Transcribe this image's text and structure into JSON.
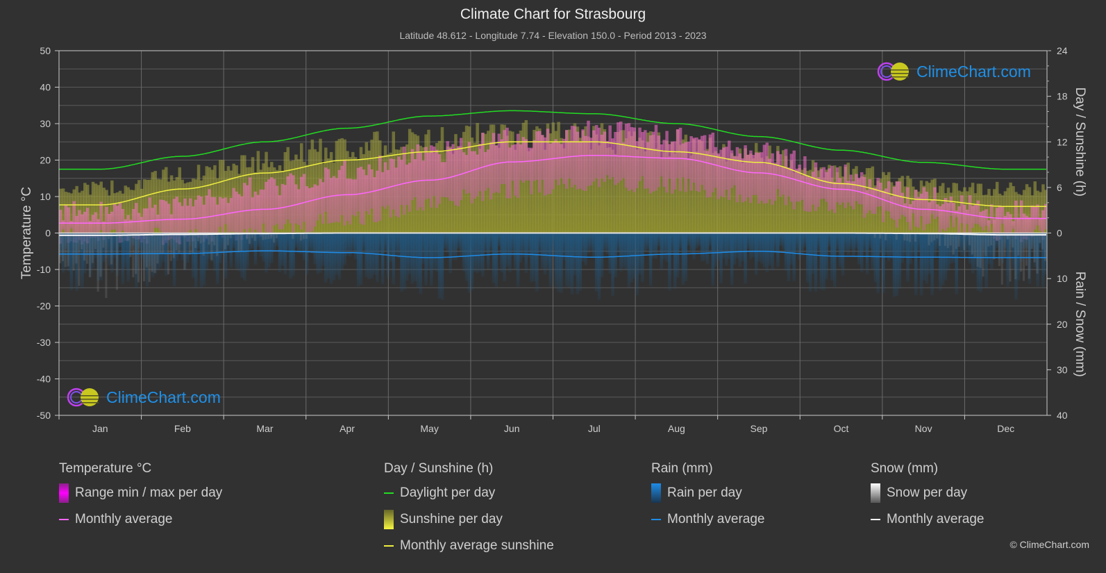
{
  "title": "Climate Chart for Strasbourg",
  "subtitle": "Latitude 48.612 - Longitude 7.74 - Elevation 150.0 - Period 2013 - 2023",
  "logo_text": "ClimeChart.com",
  "copyright": "© ClimeChart.com",
  "colors": {
    "background": "#313131",
    "temp_avg": "#ff66ff",
    "temp_range": "#e000e0",
    "daylight": "#22dd22",
    "sunshine_avg": "#f0f040",
    "sunshine_bar": "#bdbd3a",
    "rain_avg": "#1e8ce8",
    "rain_bar": "#1a70c0",
    "snow_avg": "#ffffff",
    "logo": "#1e90e8"
  },
  "legend": {
    "temperature": {
      "title": "Temperature °C",
      "items": [
        "Range min / max per day",
        "Monthly average"
      ]
    },
    "sunshine": {
      "title": "Day / Sunshine (h)",
      "items": [
        "Daylight per day",
        "Sunshine per day",
        "Monthly average sunshine"
      ]
    },
    "rain": {
      "title": "Rain (mm)",
      "items": [
        "Rain per day",
        "Monthly average"
      ]
    },
    "snow": {
      "title": "Snow (mm)",
      "items": [
        "Snow per day",
        "Monthly average"
      ]
    }
  },
  "chart_data": {
    "type": "line",
    "title": "Climate Chart for Strasbourg",
    "categories": [
      "Jan",
      "Feb",
      "Mar",
      "Apr",
      "May",
      "Jun",
      "Jul",
      "Aug",
      "Sep",
      "Oct",
      "Nov",
      "Dec"
    ],
    "y_left": {
      "label": "Temperature °C",
      "range": [
        -50,
        50
      ],
      "ticks": [
        50,
        40,
        30,
        20,
        10,
        0,
        -10,
        -20,
        -30,
        -40,
        -50
      ]
    },
    "y_right_top": {
      "label": "Day / Sunshine (h)",
      "range": [
        0,
        24
      ],
      "ticks": [
        24,
        18,
        12,
        6,
        0
      ]
    },
    "y_right_bottom": {
      "label": "Rain / Snow (mm)",
      "range": [
        0,
        40
      ],
      "ticks": [
        10,
        20,
        30,
        40
      ]
    },
    "grid": true,
    "legend_position": "bottom",
    "series": [
      {
        "name": "Temperature monthly average",
        "axis": "temp",
        "unit": "°C",
        "values": [
          2.7,
          3.8,
          6.5,
          10.5,
          14.5,
          19.5,
          21.3,
          20.5,
          16.5,
          12.0,
          6.5,
          4.0
        ]
      },
      {
        "name": "Temperature daily max (approx envelope)",
        "axis": "temp",
        "unit": "°C",
        "values": [
          6,
          8,
          13,
          17,
          22,
          26,
          28,
          27,
          22,
          16,
          10,
          6
        ]
      },
      {
        "name": "Temperature daily min (approx envelope)",
        "axis": "temp",
        "unit": "°C",
        "values": [
          -1,
          -1,
          1,
          4,
          8,
          12,
          14,
          13,
          10,
          7,
          3,
          0
        ]
      },
      {
        "name": "Daylight per day",
        "axis": "sun",
        "unit": "h",
        "values": [
          8.4,
          10.1,
          12.0,
          13.8,
          15.4,
          16.1,
          15.7,
          14.4,
          12.7,
          10.9,
          9.3,
          8.4
        ]
      },
      {
        "name": "Sunshine per day (approx max)",
        "axis": "sun",
        "unit": "h",
        "values": [
          6.5,
          8.5,
          10.5,
          12.5,
          13.5,
          14.2,
          14.0,
          13.0,
          11.5,
          9.0,
          7.0,
          6.5
        ]
      },
      {
        "name": "Monthly average sunshine",
        "axis": "sun",
        "unit": "h",
        "values": [
          3.7,
          5.8,
          7.9,
          9.6,
          10.7,
          12.0,
          12.0,
          10.7,
          9.3,
          6.5,
          4.4,
          3.5
        ]
      },
      {
        "name": "Rain monthly average",
        "axis": "rain",
        "unit": "mm",
        "values": [
          4.6,
          4.5,
          3.9,
          4.3,
          5.4,
          4.6,
          5.3,
          4.6,
          4.0,
          5.1,
          5.3,
          5.4
        ]
      },
      {
        "name": "Snow monthly average",
        "axis": "rain",
        "unit": "mm",
        "values": [
          0.5,
          0.3,
          0.1,
          0.0,
          0.0,
          0.0,
          0.0,
          0.0,
          0.0,
          0.0,
          0.1,
          0.4
        ]
      }
    ]
  }
}
